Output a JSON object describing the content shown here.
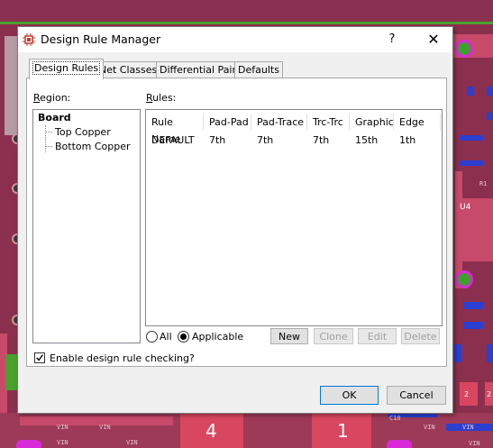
{
  "window": {
    "title": "Design Rule Manager",
    "help_label": "?",
    "close_label": "✕"
  },
  "tabs": [
    {
      "label": "Design Rules",
      "active": true
    },
    {
      "label": "Net Classes",
      "active": false
    },
    {
      "label": "Differential Pairs",
      "active": false
    },
    {
      "label": "Defaults",
      "active": false
    }
  ],
  "region": {
    "label_pre": "",
    "label_key": "R",
    "label_post": "egion:",
    "items": [
      "Board",
      "Top Copper",
      "Bottom Copper"
    ]
  },
  "rules": {
    "label_key": "R",
    "label_post": "ules:",
    "columns": [
      "Rule Name",
      "Pad-Pad",
      "Pad-Trace",
      "Trc-Trc",
      "Graphic",
      "Edge"
    ],
    "rows": [
      [
        "DEFAULT",
        "7th",
        "7th",
        "7th",
        "15th",
        "1th"
      ]
    ]
  },
  "filter": {
    "all_label": "All",
    "applicable_label": "Applicable",
    "selected": "Applicable"
  },
  "actions": {
    "new": "New",
    "clone": "Clone",
    "edit": "Edit",
    "delete": "Delete"
  },
  "enable_drc": {
    "label": "Enable design rule checking?",
    "checked": true
  },
  "footer": {
    "ok": "OK",
    "cancel": "Cancel"
  },
  "pcb": {
    "labels": [
      "4",
      "1",
      "U4",
      "2",
      "2",
      "VIN",
      "VIN",
      "VIN",
      "VIN",
      "VIN",
      "VIN",
      "VIN",
      "C10",
      "R1"
    ]
  }
}
